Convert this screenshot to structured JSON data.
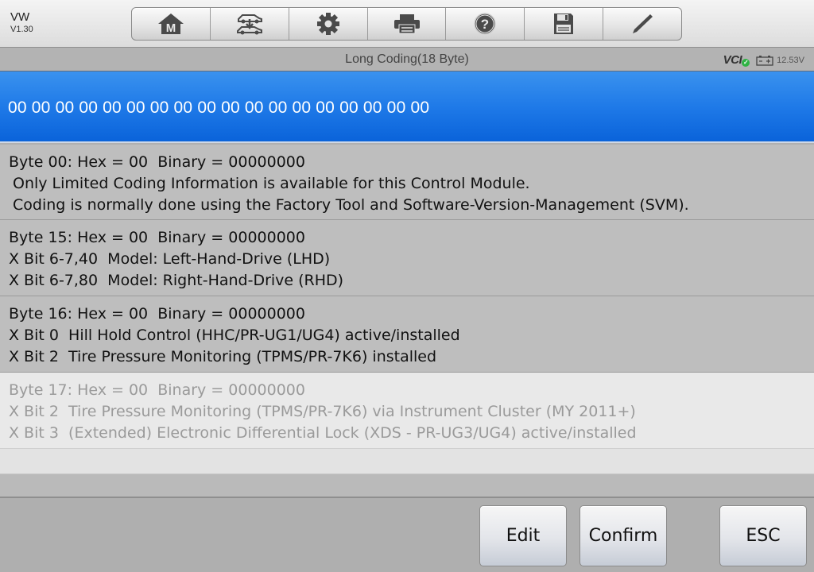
{
  "app": {
    "brand": "VW",
    "version": "V1.30"
  },
  "toolbar": {
    "items": [
      {
        "name": "home",
        "icon": "home-m-icon",
        "glyph": "M"
      },
      {
        "name": "vehicle-swap",
        "icon": "vehicle-swap-icon"
      },
      {
        "name": "settings",
        "icon": "gear-icon"
      },
      {
        "name": "print",
        "icon": "printer-icon"
      },
      {
        "name": "help",
        "icon": "help-icon",
        "glyph": "?"
      },
      {
        "name": "save",
        "icon": "floppy-disk-icon"
      },
      {
        "name": "edit",
        "icon": "pencil-icon"
      }
    ]
  },
  "titlebar": {
    "title": "Long Coding(18 Byte)",
    "vci_label": "VCI",
    "vci_status": "connected",
    "vci_status_color": "#2fb344",
    "battery_voltage": "12.53V"
  },
  "coding": {
    "value": "00 00 00 00 00 00 00 00 00 00 00 00 00 00 00 00 00 00",
    "accent_color": "#1f7ae8"
  },
  "rows": [
    {
      "header": "Byte 00: Hex = 00  Binary = 00000000",
      "lines": [
        "Only Limited Coding Information is available for this Control Module.",
        "Coding is normally done using the Factory Tool and Software-Version-Management (SVM)."
      ],
      "enabled": true
    },
    {
      "header": "Byte 15: Hex = 00  Binary = 00000000",
      "lines": [
        "X Bit 6-7,40  Model: Left-Hand-Drive (LHD)",
        "X Bit 6-7,80  Model: Right-Hand-Drive (RHD)"
      ],
      "enabled": true
    },
    {
      "header": "Byte 16: Hex = 00  Binary = 00000000",
      "lines": [
        "X Bit 0  Hill Hold Control (HHC/PR-UG1/UG4) active/installed",
        "X Bit 2  Tire Pressure Monitoring (TPMS/PR-7K6) installed"
      ],
      "enabled": true
    },
    {
      "header": "Byte 17: Hex = 00  Binary = 00000000",
      "lines": [
        "X Bit 2  Tire Pressure Monitoring (TPMS/PR-7K6) via Instrument Cluster (MY 2011+)",
        "X Bit 3  (Extended) Electronic Differential Lock (XDS - PR-UG3/UG4) active/installed"
      ],
      "enabled": false
    }
  ],
  "footer": {
    "edit_label": "Edit",
    "confirm_label": "Confirm",
    "esc_label": "ESC"
  }
}
